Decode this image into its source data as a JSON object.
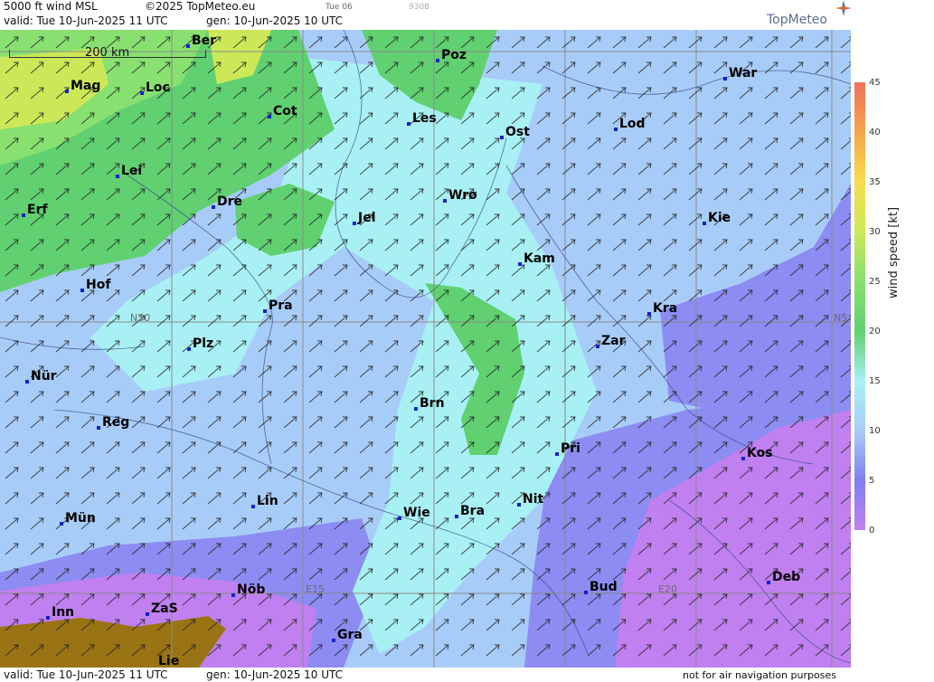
{
  "header": {
    "title": "5000 ft wind MSL",
    "copyright": "©2025 TopMeteo.eu",
    "tab": "Tue 06",
    "code": "9308",
    "valid": "valid:  Tue  10-Jun-2025  11 UTC",
    "gen": "gen: 10-Jun-2025 10 UTC",
    "logo": "TopMeteo"
  },
  "footer": {
    "valid": "valid:  Tue  10-Jun-2025  11 UTC",
    "gen": "gen: 10-Jun-2025 10 UTC",
    "disclaimer": "not for air navigation purposes"
  },
  "map": {
    "scale_label": "200 km",
    "grid_labels": [
      "N50",
      "N5",
      "E15",
      "E20"
    ],
    "cities": [
      {
        "name": "Ber"
      },
      {
        "name": "Poz"
      },
      {
        "name": "War"
      },
      {
        "name": "Mag"
      },
      {
        "name": "Loc"
      },
      {
        "name": "Cot"
      },
      {
        "name": "Les"
      },
      {
        "name": "Ost"
      },
      {
        "name": "Lod"
      },
      {
        "name": "Lei"
      },
      {
        "name": "Dre"
      },
      {
        "name": "Wrø"
      },
      {
        "name": "Erf"
      },
      {
        "name": "Jel"
      },
      {
        "name": "Kie"
      },
      {
        "name": "Kam"
      },
      {
        "name": "Hof"
      },
      {
        "name": "Pra"
      },
      {
        "name": "Kra"
      },
      {
        "name": "Plz"
      },
      {
        "name": "Zar"
      },
      {
        "name": "Nür"
      },
      {
        "name": "Brn"
      },
      {
        "name": "Reg"
      },
      {
        "name": "Pri"
      },
      {
        "name": "Kos"
      },
      {
        "name": "Lin"
      },
      {
        "name": "Nit"
      },
      {
        "name": "Mün"
      },
      {
        "name": "Wie"
      },
      {
        "name": "Bra"
      },
      {
        "name": "Nöb"
      },
      {
        "name": "Bud"
      },
      {
        "name": "Deb"
      },
      {
        "name": "Inn"
      },
      {
        "name": "ZaS"
      },
      {
        "name": "Gra"
      },
      {
        "name": "Lie"
      }
    ]
  },
  "legend": {
    "unit_label": "wind  speed  [kt]",
    "ticks": [
      "45",
      "40",
      "35",
      "30",
      "25",
      "20",
      "15",
      "10",
      "5",
      "0"
    ],
    "colors": [
      "#f07060",
      "#f5a54a",
      "#f8dc50",
      "#cce858",
      "#88e070",
      "#60d070",
      "#a8f0f4",
      "#a8ccf8",
      "#8080f0",
      "#c080f0"
    ]
  }
}
